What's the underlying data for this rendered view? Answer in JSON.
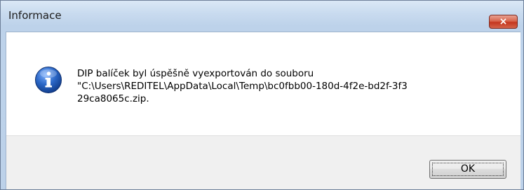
{
  "window": {
    "title": "Informace",
    "close_glyph": "×"
  },
  "dialog": {
    "icon": "information-icon",
    "message": "DIP balíček byl úspěšně vyexportován do souboru\n\"C:\\Users\\REDITEL\\AppData\\Local\\Temp\\bc0fbb00-180d-4f2e-bd2f-3f3\n29ca8065c.zip.",
    "ok_label": "OK"
  },
  "colors": {
    "titlebar": "#c9dbef",
    "close_button": "#c4361e",
    "info_icon": "#2b67c6",
    "footer": "#f0f0f0"
  }
}
